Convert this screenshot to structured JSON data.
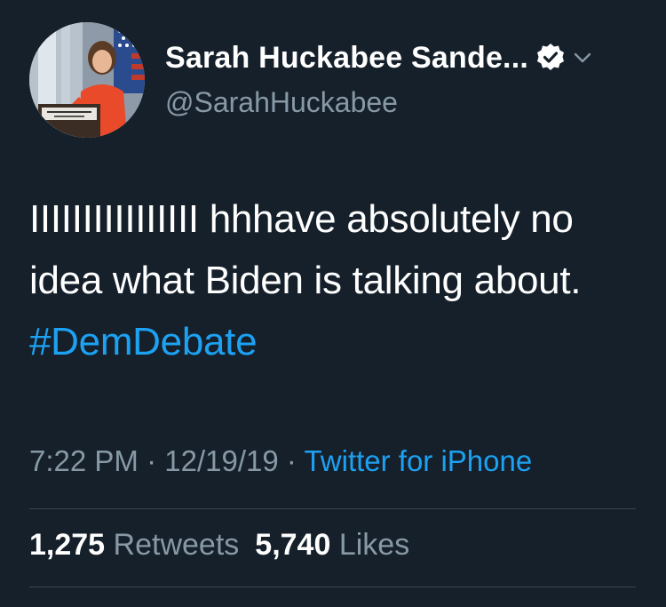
{
  "tweet": {
    "author": {
      "display_name": "Sarah Huckabee Sande...",
      "handle": "@SarahHuckabee",
      "verified_icon": "verified-badge-icon",
      "menu_icon": "chevron-down-icon"
    },
    "text": {
      "main": "IIIIIIIIIIIIIIII hhhave absolutely no idea what Biden is talking about. ",
      "hashtag": "#DemDebate"
    },
    "meta": {
      "time": "7:22 PM",
      "separator1": " · ",
      "date": "12/19/19",
      "separator2": " · ",
      "source": "Twitter for iPhone"
    },
    "stats": {
      "retweets_count": "1,275",
      "retweets_label": "Retweets",
      "likes_count": "5,740",
      "likes_label": "Likes"
    }
  },
  "colors": {
    "background": "#15202b",
    "accent": "#1da1f2",
    "secondary_text": "#8899a6",
    "divider": "#38444d"
  }
}
